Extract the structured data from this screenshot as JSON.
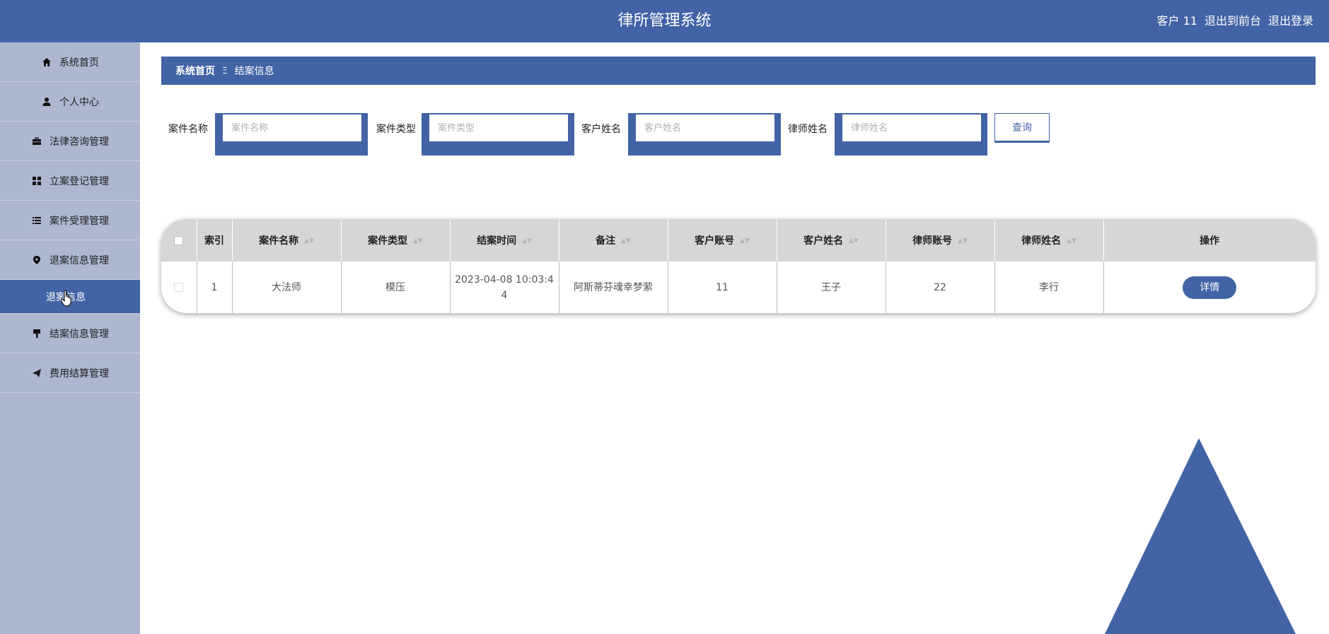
{
  "header": {
    "title": "律所管理系统",
    "user_label": "客户 11",
    "front_label": "退出到前台",
    "logout_label": "退出登录"
  },
  "sidebar": {
    "items": [
      {
        "label": "系统首页",
        "icon": "home-icon"
      },
      {
        "label": "个人中心",
        "icon": "user-icon"
      },
      {
        "label": "法律咨询管理",
        "icon": "briefcase-icon"
      },
      {
        "label": "立案登记管理",
        "icon": "grid-icon"
      },
      {
        "label": "案件受理管理",
        "icon": "list-icon"
      },
      {
        "label": "退案信息管理",
        "icon": "pin-icon"
      }
    ],
    "subitem": {
      "label": "退案信息"
    },
    "items_after": [
      {
        "label": "结案信息管理",
        "icon": "stamp-icon"
      },
      {
        "label": "费用结算管理",
        "icon": "send-icon"
      }
    ]
  },
  "breadcrumb": {
    "home": "系统首页",
    "separator": "Ξ",
    "current": "结案信息"
  },
  "search": {
    "fields": [
      {
        "label": "案件名称",
        "placeholder": "案件名称"
      },
      {
        "label": "案件类型",
        "placeholder": "案件类型"
      },
      {
        "label": "客户姓名",
        "placeholder": "客户姓名"
      },
      {
        "label": "律师姓名",
        "placeholder": "律师姓名"
      }
    ],
    "button": "查询"
  },
  "table": {
    "headers": [
      "索引",
      "案件名称",
      "案件类型",
      "结案时间",
      "备注",
      "客户账号",
      "客户姓名",
      "律师账号",
      "律师姓名",
      "操作"
    ],
    "rows": [
      [
        "1",
        "大法师",
        "模压",
        "2023-04-08 10:03:44",
        "阿斯蒂芬魂幸梦萦",
        "11",
        "王子",
        "22",
        "李行",
        "详情"
      ]
    ]
  },
  "colors": {
    "primary": "#4263a5",
    "sidebar": "#aeb6d0"
  }
}
